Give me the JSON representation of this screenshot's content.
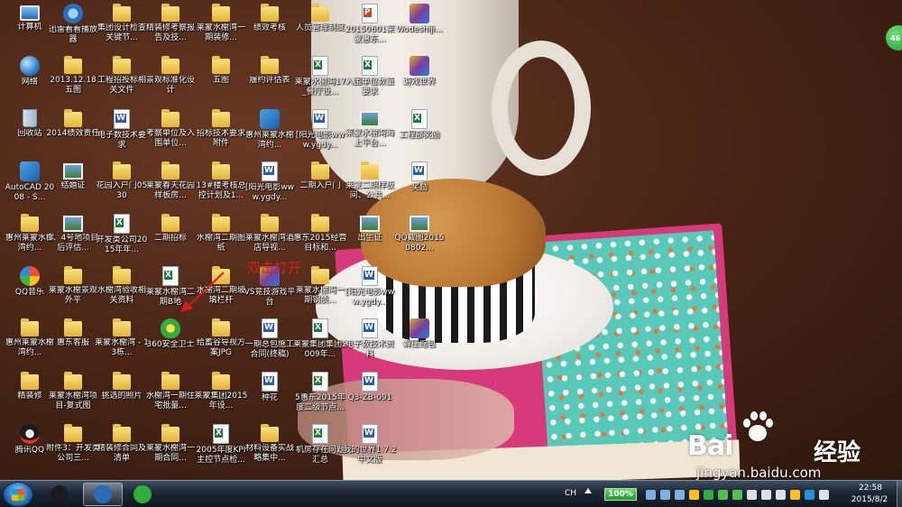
{
  "desktop_icons": [
    {
      "label": "计算机",
      "type": "pc",
      "col": 0,
      "row": 0
    },
    {
      "label": "网络",
      "type": "net",
      "col": 0,
      "row": 1
    },
    {
      "label": "回收站",
      "type": "bin",
      "col": 0,
      "row": 2
    },
    {
      "label": "AutoCAD 2008 - S...",
      "type": "app",
      "col": 0,
      "row": 3
    },
    {
      "label": "惠州莱蒙水榭湾约...",
      "type": "folder",
      "col": 0,
      "row": 4
    },
    {
      "label": "QQ音乐",
      "type": "music",
      "col": 0,
      "row": 5
    },
    {
      "label": "惠州莱蒙水榭湾约...",
      "type": "folder",
      "col": 0,
      "row": 6
    },
    {
      "label": "精装修",
      "type": "folder",
      "col": 0,
      "row": 7
    },
    {
      "label": "腾讯QQ",
      "type": "penguin",
      "col": 0,
      "row": 8
    },
    {
      "label": "迅雷看看播放器",
      "type": "media",
      "col": 1,
      "row": 0
    },
    {
      "label": "2013.12.18五图",
      "type": "folder",
      "col": 1,
      "row": 1
    },
    {
      "label": "2014绩效责任",
      "type": "folder",
      "col": 1,
      "row": 2
    },
    {
      "label": "结婚证",
      "type": "img",
      "col": 1,
      "row": 3
    },
    {
      "label": "3、4号地项目后评估...",
      "type": "img",
      "col": 1,
      "row": 4
    },
    {
      "label": "莱蒙水榭景观外平",
      "type": "folder",
      "col": 1,
      "row": 5
    },
    {
      "label": "惠东客服",
      "type": "folder",
      "col": 1,
      "row": 6
    },
    {
      "label": "莱蒙水榭湾项目-复式图",
      "type": "folder",
      "col": 1,
      "row": 7
    },
    {
      "label": "附件3：开发类公司三...",
      "type": "folder",
      "col": 1,
      "row": 8
    },
    {
      "label": "集团设计检查关键节...",
      "type": "folder",
      "col": 2,
      "row": 0
    },
    {
      "label": "工程招投标相关文件",
      "type": "folder",
      "col": 2,
      "row": 1
    },
    {
      "label": "电子数技术要求",
      "type": "doc",
      "col": 2,
      "row": 2
    },
    {
      "label": "花园入户门0530",
      "type": "folder",
      "col": 2,
      "row": 3
    },
    {
      "label": "开发类公司2015年年...",
      "type": "xls",
      "col": 2,
      "row": 4
    },
    {
      "label": "水榭湾验收相关资料",
      "type": "folder",
      "col": 2,
      "row": 5
    },
    {
      "label": "莱蒙水榭湾 - 13栋...",
      "type": "folder",
      "col": 2,
      "row": 6
    },
    {
      "label": "挑选的照片",
      "type": "folder",
      "col": 2,
      "row": 7
    },
    {
      "label": "精装修合同及清单",
      "type": "folder",
      "col": 2,
      "row": 8
    },
    {
      "label": "精装修考察报告及技...",
      "type": "folder",
      "col": 3,
      "row": 0
    },
    {
      "label": "景观标准化设计",
      "type": "folder",
      "col": 3,
      "row": 1
    },
    {
      "label": "考察单位及入围单位...",
      "type": "folder",
      "col": 3,
      "row": 2
    },
    {
      "label": "莱蒙春天花园样板房...",
      "type": "folder",
      "col": 3,
      "row": 3
    },
    {
      "label": "二期招标",
      "type": "folder",
      "col": 3,
      "row": 4
    },
    {
      "label": "莱蒙水榭湾二期B地",
      "type": "xls",
      "col": 3,
      "row": 5
    },
    {
      "label": "360安全卫士",
      "type": "shield",
      "col": 3,
      "row": 6
    },
    {
      "label": "水榭湾一期住宅批量...",
      "type": "folder",
      "col": 3,
      "row": 7
    },
    {
      "label": "莱蒙水榭湾一期合同...",
      "type": "folder",
      "col": 3,
      "row": 8
    },
    {
      "label": "莱蒙水榭湾一期装修...",
      "type": "folder",
      "col": 4,
      "row": 0
    },
    {
      "label": "五图",
      "type": "folder",
      "col": 4,
      "row": 1
    },
    {
      "label": "招标技术要求附件",
      "type": "folder",
      "col": 4,
      "row": 2
    },
    {
      "label": "13#楼考核总控计划及1...",
      "type": "folder",
      "col": 4,
      "row": 3
    },
    {
      "label": "水榭湾二期图纸",
      "type": "folder",
      "col": 4,
      "row": 4
    },
    {
      "label": "水榭湾二期玻璃栏杆",
      "type": "folder",
      "col": 4,
      "row": 5
    },
    {
      "label": "给蓄谷导视方案JPG",
      "type": "folder",
      "col": 4,
      "row": 6
    },
    {
      "label": "莱蒙集团2015年设...",
      "type": "folder",
      "col": 4,
      "row": 7
    },
    {
      "label": "2005年度KPI主控节点检...",
      "type": "xls",
      "col": 4,
      "row": 8
    },
    {
      "label": "绩效考核",
      "type": "folder",
      "col": 5,
      "row": 0
    },
    {
      "label": "履约评估表",
      "type": "folder",
      "col": 5,
      "row": 1
    },
    {
      "label": "惠州莱蒙水榭湾约...",
      "type": "app",
      "col": 5,
      "row": 2
    },
    {
      "label": "[阳光电影www.ygdy...",
      "type": "doc",
      "col": 5,
      "row": 3
    },
    {
      "label": "莱蒙水榭湾酒店导视...",
      "type": "folder",
      "col": 5,
      "row": 4
    },
    {
      "label": "VS竞技游戏平台",
      "type": "game",
      "col": 5,
      "row": 5
    },
    {
      "label": "一期总包施工合同(终稿)",
      "type": "doc",
      "col": 5,
      "row": 6
    },
    {
      "label": "种花",
      "type": "doc",
      "col": 5,
      "row": 7
    },
    {
      "label": "材料设备实战略集中...",
      "type": "folder",
      "col": 5,
      "row": 8
    },
    {
      "label": "人员管理制度",
      "type": "folder",
      "col": 6,
      "row": 0
    },
    {
      "label": "莱蒙水榭湾17_餐厅设...",
      "type": "xls",
      "col": 6,
      "row": 1
    },
    {
      "label": "[阳光电影www.ygdy...",
      "type": "doc",
      "col": 6,
      "row": 2
    },
    {
      "label": "二期入户门",
      "type": "folder",
      "col": 6,
      "row": 3
    },
    {
      "label": "惠东2015经营目标和...",
      "type": "folder",
      "col": 6,
      "row": 4
    },
    {
      "label": "莱蒙水榭湾一期钢质...",
      "type": "folder",
      "col": 6,
      "row": 5
    },
    {
      "label": "莱蒙集团集团2009年...",
      "type": "xls",
      "col": 6,
      "row": 6
    },
    {
      "label": "5惠东2015年度二级节点...",
      "type": "xls",
      "col": 6,
      "row": 7
    },
    {
      "label": "机房存在问题汇总",
      "type": "xls",
      "col": 6,
      "row": 8
    },
    {
      "label": "20150601莱蒙惠东...",
      "type": "ppt",
      "col": 7,
      "row": 0
    },
    {
      "label": "入围单位数量要求",
      "type": "xls",
      "col": 7,
      "row": 1
    },
    {
      "label": "莱蒙水榭湾海上平台...",
      "type": "img",
      "col": 7,
      "row": 2
    },
    {
      "label": "莱蒙二期样板间、公共...",
      "type": "folder",
      "col": 7,
      "row": 3
    },
    {
      "label": "出生证",
      "type": "img",
      "col": 7,
      "row": 4
    },
    {
      "label": "[阳光电影www.ygdy...",
      "type": "doc",
      "col": 7,
      "row": 5
    },
    {
      "label": "电子数技术资料",
      "type": "doc",
      "col": 7,
      "row": 6
    },
    {
      "label": "Q3-ZB-091",
      "type": "doc",
      "col": 7,
      "row": 7
    },
    {
      "label": "我的世界1.7.2 中文版",
      "type": "doc",
      "col": 7,
      "row": 8
    },
    {
      "label": "Wodeshiji...",
      "type": "game",
      "col": 8,
      "row": 0
    },
    {
      "label": "游戏世界",
      "type": "game",
      "col": 8,
      "row": 1
    },
    {
      "label": "工程部奖励",
      "type": "xls",
      "col": 8,
      "row": 2
    },
    {
      "label": "奖励",
      "type": "doc",
      "col": 8,
      "row": 3
    },
    {
      "label": "QQ截图20150802...",
      "type": "img",
      "col": 8,
      "row": 4
    },
    {
      "label": "解压缩包",
      "type": "game",
      "col": 8,
      "row": 6
    }
  ],
  "annotation": {
    "text": "双击打开",
    "color": "#d91c1c"
  },
  "widget": {
    "text": "46"
  },
  "watermark": {
    "brand": "Bai",
    "brand2": "经验",
    "url": "jingyan.baidu.com"
  },
  "taskbar": {
    "pinned": [
      {
        "name": "qq-penguin-icon",
        "color": "#1b1b1b"
      },
      {
        "name": "explorer-app-icon",
        "color": "#2a6bb6",
        "active": true
      },
      {
        "name": "refresh-app-icon",
        "color": "#2fae3c"
      }
    ],
    "ime_label": "CH",
    "battery": "100%",
    "tray_icons": [
      {
        "name": "tray-app-icon-1",
        "color": "#7fb0e0"
      },
      {
        "name": "tray-app-icon-2",
        "color": "#7fb0e0"
      },
      {
        "name": "tray-app-icon-3",
        "color": "#7fb0e0"
      },
      {
        "name": "tray-app-icon-4",
        "color": "#ffc21c"
      },
      {
        "name": "tray-app-icon-5",
        "color": "#2fae3c"
      },
      {
        "name": "tray-shield-icon",
        "color": "#4ec14e"
      },
      {
        "name": "tray-app-icon-7",
        "color": "#4ec14e"
      },
      {
        "name": "tray-volume-icon",
        "color": "#e0e0e0"
      },
      {
        "name": "tray-network-icon",
        "color": "#e0e0e0"
      },
      {
        "name": "tray-flag-icon",
        "color": "#e0e0e0"
      },
      {
        "name": "tray-app-icon-11",
        "color": "#ffc21c"
      },
      {
        "name": "tray-app-icon-12",
        "color": "#2d8ce0"
      },
      {
        "name": "tray-app-icon-13",
        "color": "#e0e0e0"
      }
    ],
    "time": "22:58",
    "date": "2015/8/2"
  }
}
